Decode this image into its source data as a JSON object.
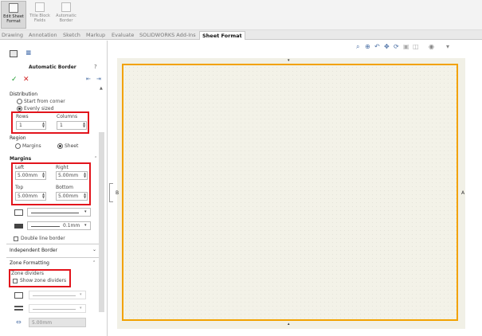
{
  "ribbon": {
    "edit_sheet": "Edit Sheet Format",
    "title_block": "Title Block Fields",
    "automatic_border": "Automatic Border"
  },
  "tabs": [
    "Drawing",
    "Annotation",
    "Sketch",
    "Markup",
    "Evaluate",
    "SOLIDWORKS Add-Ins",
    "Sheet Format"
  ],
  "panel": {
    "title": "Automatic Border",
    "distribution_label": "Distribution",
    "distribution_options": [
      "Start from corner",
      "Evenly sized"
    ],
    "rows_label": "Rows",
    "rows_value": "1",
    "columns_label": "Columns",
    "columns_value": "1",
    "region_label": "Region",
    "region_options": [
      "Margins",
      "Sheet"
    ],
    "margins_label": "Margins",
    "left_label": "Left",
    "left_value": "5.00mm",
    "right_label": "Right",
    "right_value": "5.00mm",
    "top_label": "Top",
    "top_value": "5.00mm",
    "bottom_label": "Bottom",
    "bottom_value": "5.00mm",
    "line_thickness": "0.1mm",
    "double_line_label": "Double line border",
    "independent_border": "Independent Border",
    "zone_formatting": "Zone Formatting",
    "zone_dividers_label": "Zone dividers",
    "show_dividers_label": "Show zone dividers",
    "zone_size": "5.00mm"
  },
  "canvas": {
    "marker_left": "B",
    "marker_right": "A"
  },
  "colors": {
    "accent_red": "#e2141c",
    "sheet_border": "#f2a200",
    "canvas_bg": "#f1f0e6"
  }
}
